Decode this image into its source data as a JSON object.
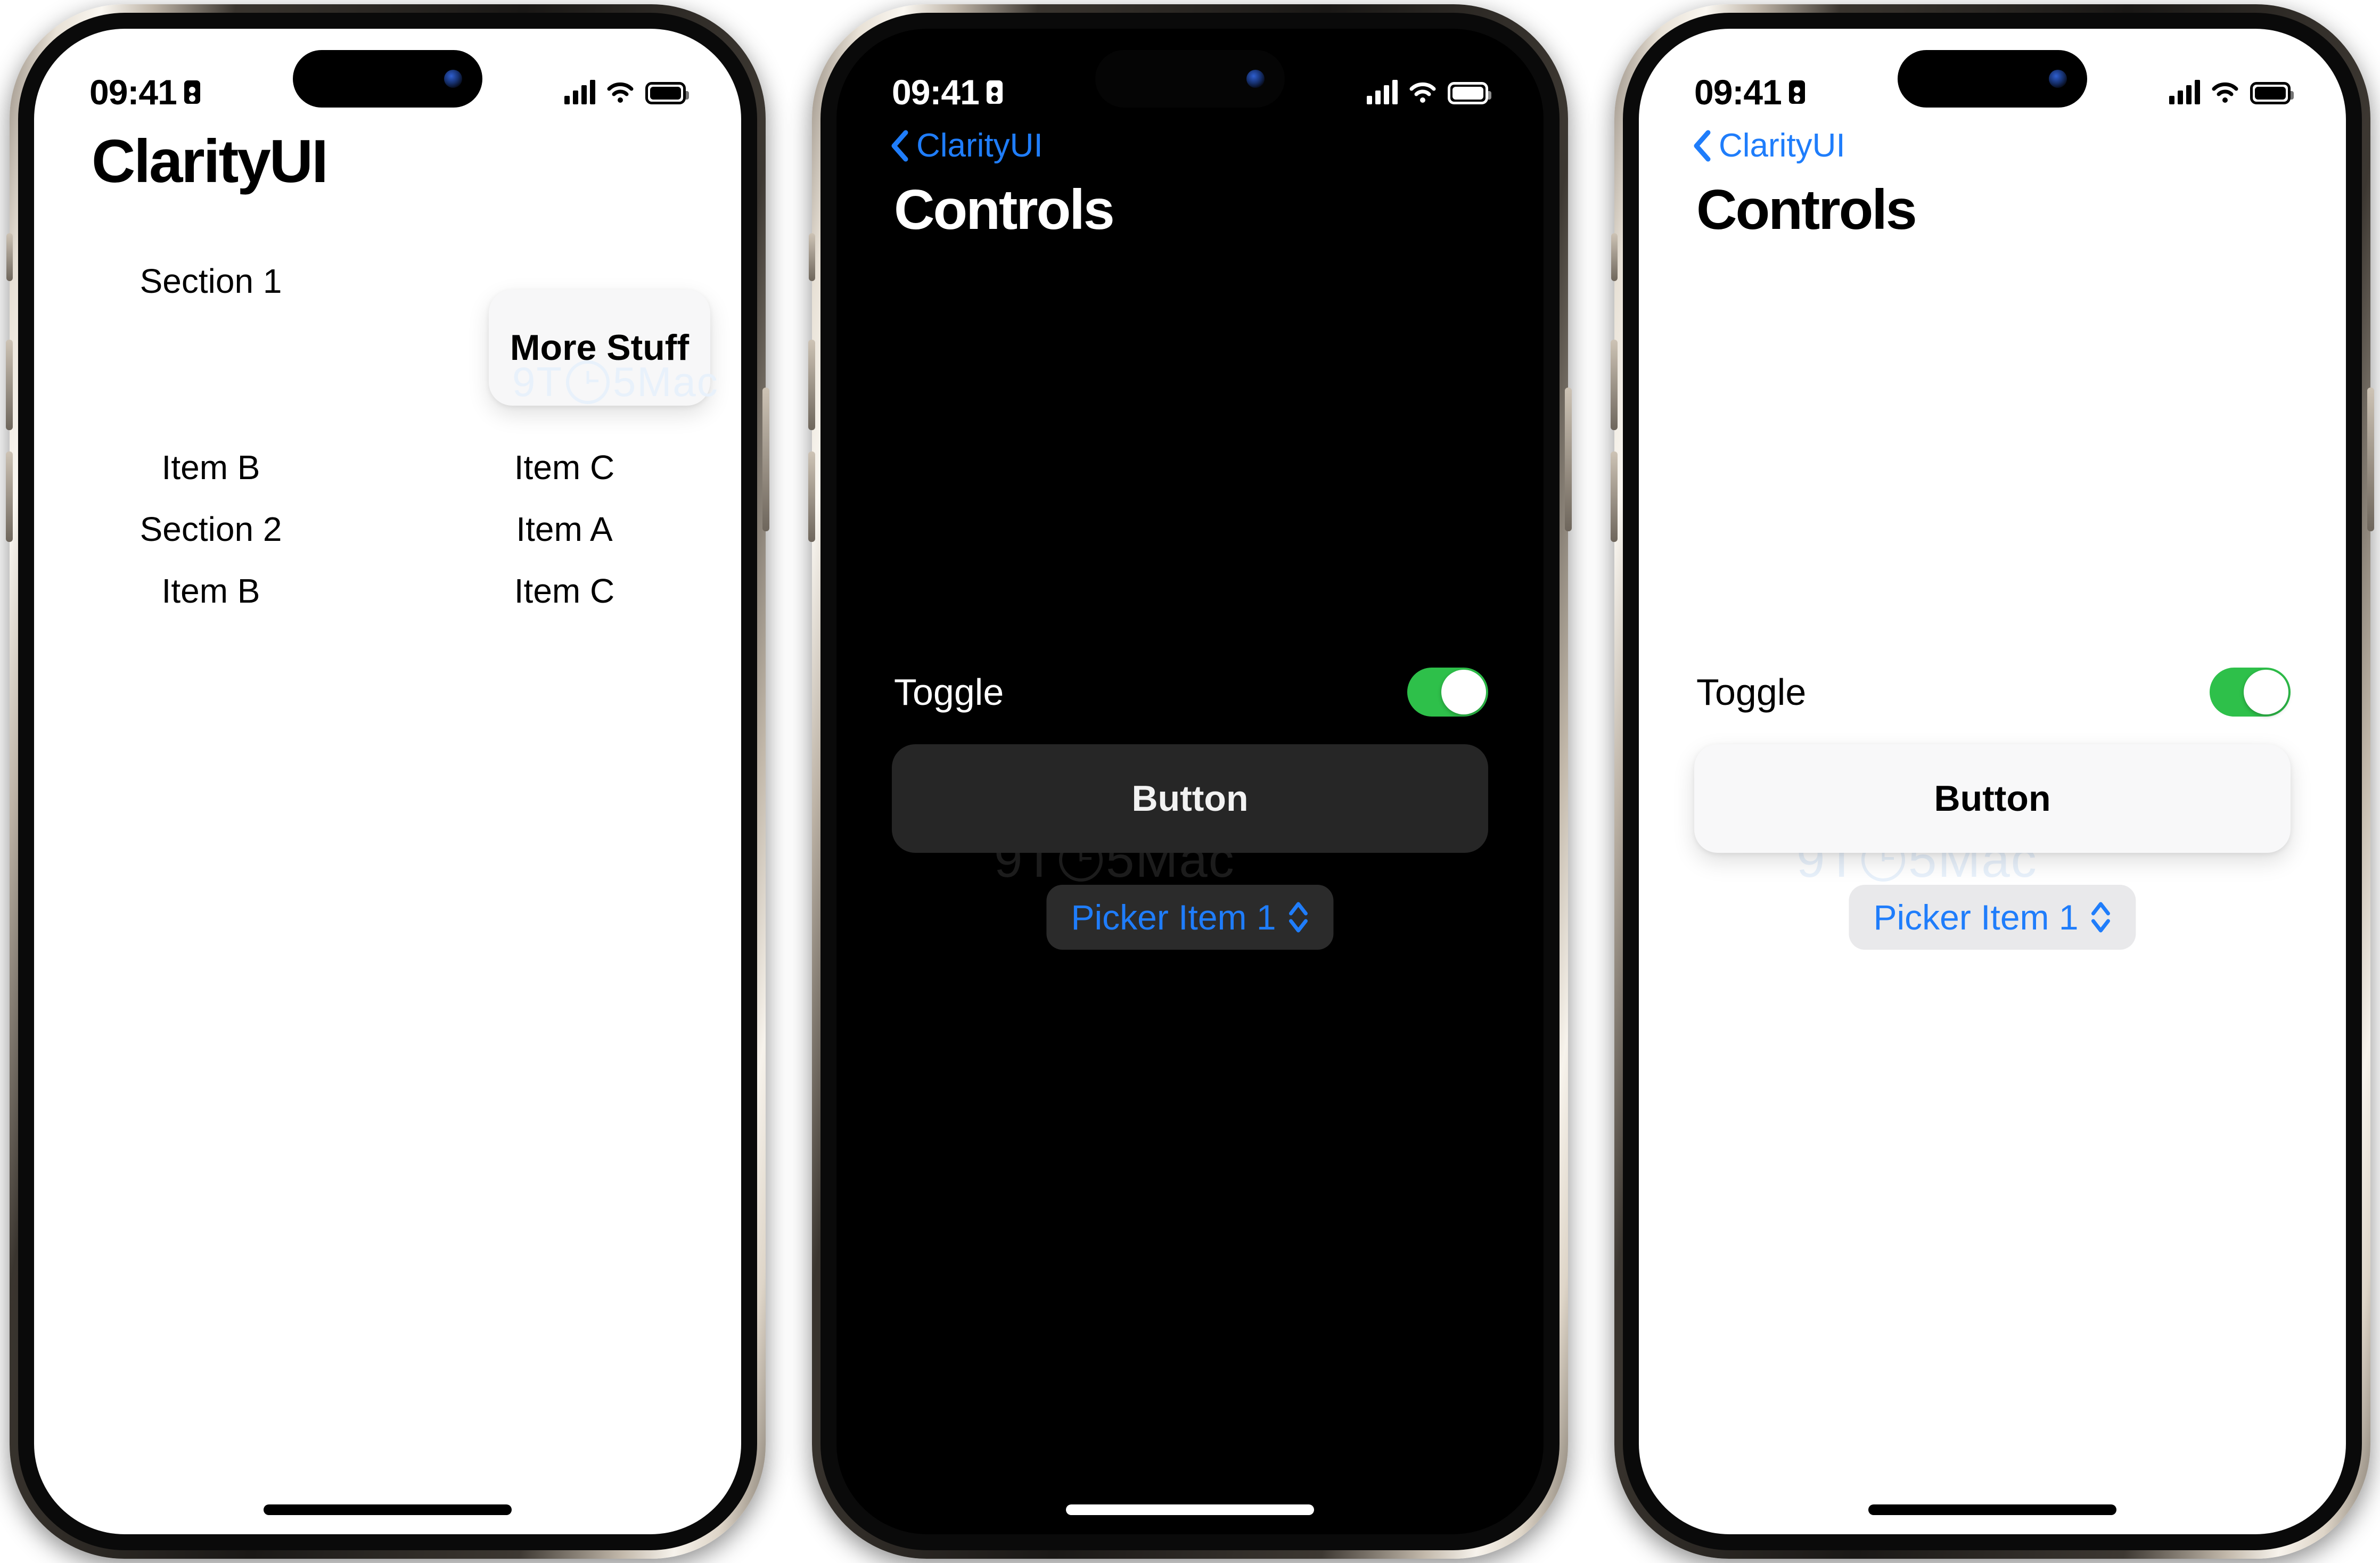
{
  "statusbar": {
    "time": "09:41",
    "badge_icon": "id-badge-icon",
    "signal_icon": "cellular-signal-icon",
    "wifi_icon": "wifi-icon",
    "battery_icon": "battery-icon"
  },
  "watermark": {
    "text_before": "9T",
    "text_after": "5Mac"
  },
  "colors": {
    "accent_blue": "#1F7DFB",
    "toggle_green": "#2EC04A",
    "dark_bg": "#000000",
    "light_bg": "#FFFFFF",
    "dark_surface": "#262626",
    "light_surface": "#F8F8F9"
  },
  "phones": [
    {
      "name": "clarityui-home-light",
      "theme": "light",
      "title": "ClarityUI",
      "card": {
        "label": "More Stuff"
      },
      "rows": [
        {
          "left": "Section 1",
          "right": ""
        },
        {
          "left": "",
          "right": ""
        },
        {
          "left": "Item B",
          "right": "Item C"
        },
        {
          "left": "Section 2",
          "right": "Item A"
        },
        {
          "left": "Item B",
          "right": "Item C"
        }
      ]
    },
    {
      "name": "controls-dark",
      "theme": "dark",
      "back_label": "ClarityUI",
      "back_icon": "chevron-left-icon",
      "title": "Controls",
      "toggle": {
        "label": "Toggle",
        "state": "on"
      },
      "button": {
        "label": "Button"
      },
      "picker": {
        "value": "Picker Item 1",
        "icon": "chevron-up-down-icon"
      }
    },
    {
      "name": "controls-light",
      "theme": "light",
      "back_label": "ClarityUI",
      "back_icon": "chevron-left-icon",
      "title": "Controls",
      "toggle": {
        "label": "Toggle",
        "state": "on"
      },
      "button": {
        "label": "Button"
      },
      "picker": {
        "value": "Picker Item 1",
        "icon": "chevron-up-down-icon"
      }
    }
  ]
}
